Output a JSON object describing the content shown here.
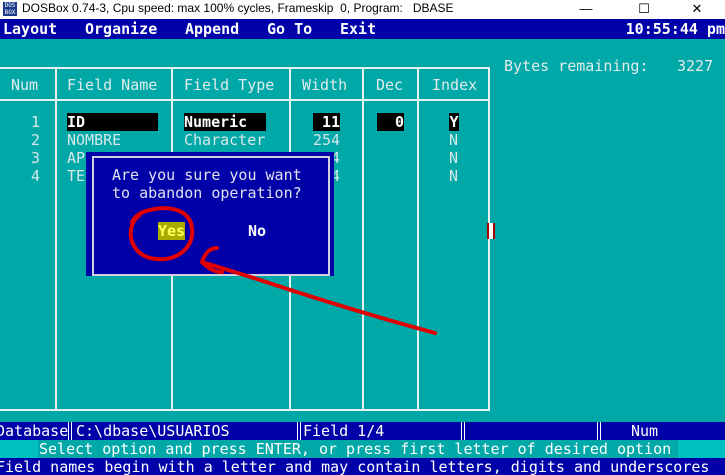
{
  "window": {
    "title": "DOSBox 0.74-3, Cpu speed: max 100% cycles, Frameskip  0, Program:   DBASE",
    "icon_text": "DOS\nBOX",
    "minimize": "—",
    "maximize": "☐",
    "close": "✕"
  },
  "menu": {
    "items": [
      "Layout",
      "Organize",
      "Append",
      "Go To",
      "Exit"
    ],
    "clock": "10:55:44 pm"
  },
  "bytes": {
    "label": "Bytes remaining:",
    "value": "3227"
  },
  "table": {
    "headers": [
      "Num",
      "Field Name",
      "Field Type",
      "Width",
      "Dec",
      "Index"
    ],
    "rows": [
      {
        "num": "1",
        "name": "ID",
        "type": "Numeric",
        "width": "11",
        "dec": "0",
        "index": "Y"
      },
      {
        "num": "2",
        "name": "NOMBRE",
        "type": "Character",
        "width": "254",
        "dec": "",
        "index": "N"
      },
      {
        "num": "3",
        "name": "AP",
        "type": "",
        "width": "4",
        "dec": "",
        "index": "N"
      },
      {
        "num": "4",
        "name": "TE",
        "type": "",
        "width": "4",
        "dec": "",
        "index": "N"
      }
    ]
  },
  "dialog": {
    "line1": "Are you sure you want",
    "line2": "to abandon operation?",
    "yes": "Yes",
    "no": "No"
  },
  "status": {
    "section": "Database",
    "path": "C:\\dbase\\USUARIOS",
    "field": "Field 1/4",
    "mode": "Num"
  },
  "messages": {
    "line1": "Select option and press ENTER, or press first letter of desired option",
    "line2": "Field names begin with a letter and may contain letters, digits and underscores"
  },
  "colors": {
    "dos_cyan": "#00a8a8",
    "dos_blue": "#0000a8",
    "annotation_red": "#e00000"
  }
}
